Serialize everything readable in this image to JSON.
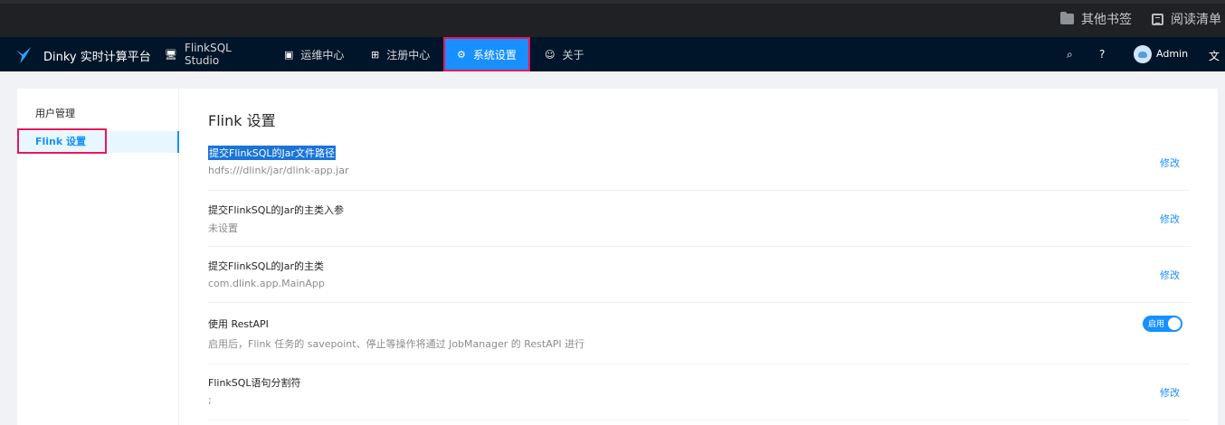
{
  "browser": {
    "bookmarks": [
      {
        "label": "其他书签",
        "icon": "folder-icon"
      },
      {
        "label": "阅读清单",
        "icon": "reading-list-icon"
      }
    ]
  },
  "header": {
    "brand": "Dinky 实时计算平台",
    "nav": [
      {
        "label": "FlinkSQL Studio",
        "icon": "monitor-icon"
      },
      {
        "label": "运维中心",
        "icon": "dashboard-icon"
      },
      {
        "label": "注册中心",
        "icon": "grid-icon"
      },
      {
        "label": "系统设置",
        "icon": "settings-icon",
        "active": true
      },
      {
        "label": "关于",
        "icon": "smile-icon"
      }
    ],
    "user": "Admin",
    "right_icons": [
      "search-icon",
      "question-icon",
      "translate-icon"
    ]
  },
  "sidebar": {
    "items": [
      {
        "label": "用户管理"
      },
      {
        "label": "Flink 设置",
        "selected": true
      }
    ]
  },
  "main": {
    "title": "Flink 设置",
    "settings": [
      {
        "title": "提交FlinkSQL的Jar文件路径",
        "desc": "hdfs:///dlink/jar/dlink-app.jar",
        "action": "修改"
      },
      {
        "title": "提交FlinkSQL的Jar的主类入参",
        "desc": "未设置",
        "action": "修改"
      },
      {
        "title": "提交FlinkSQL的Jar的主类",
        "desc": "com.dlink.app.MainApp",
        "action": "修改"
      },
      {
        "title": "使用 RestAPI",
        "desc": "启用后，Flink 任务的 savepoint、停止等操作将通过 JobManager 的 RestAPI 进行",
        "toggle_label": "启用",
        "enabled": true
      },
      {
        "title": "FlinkSQL语句分割符",
        "desc": ";",
        "action": "修改"
      }
    ]
  },
  "colors": {
    "primary": "#1890ff",
    "header_bg": "#001529",
    "highlight_border": "#e8175d"
  }
}
